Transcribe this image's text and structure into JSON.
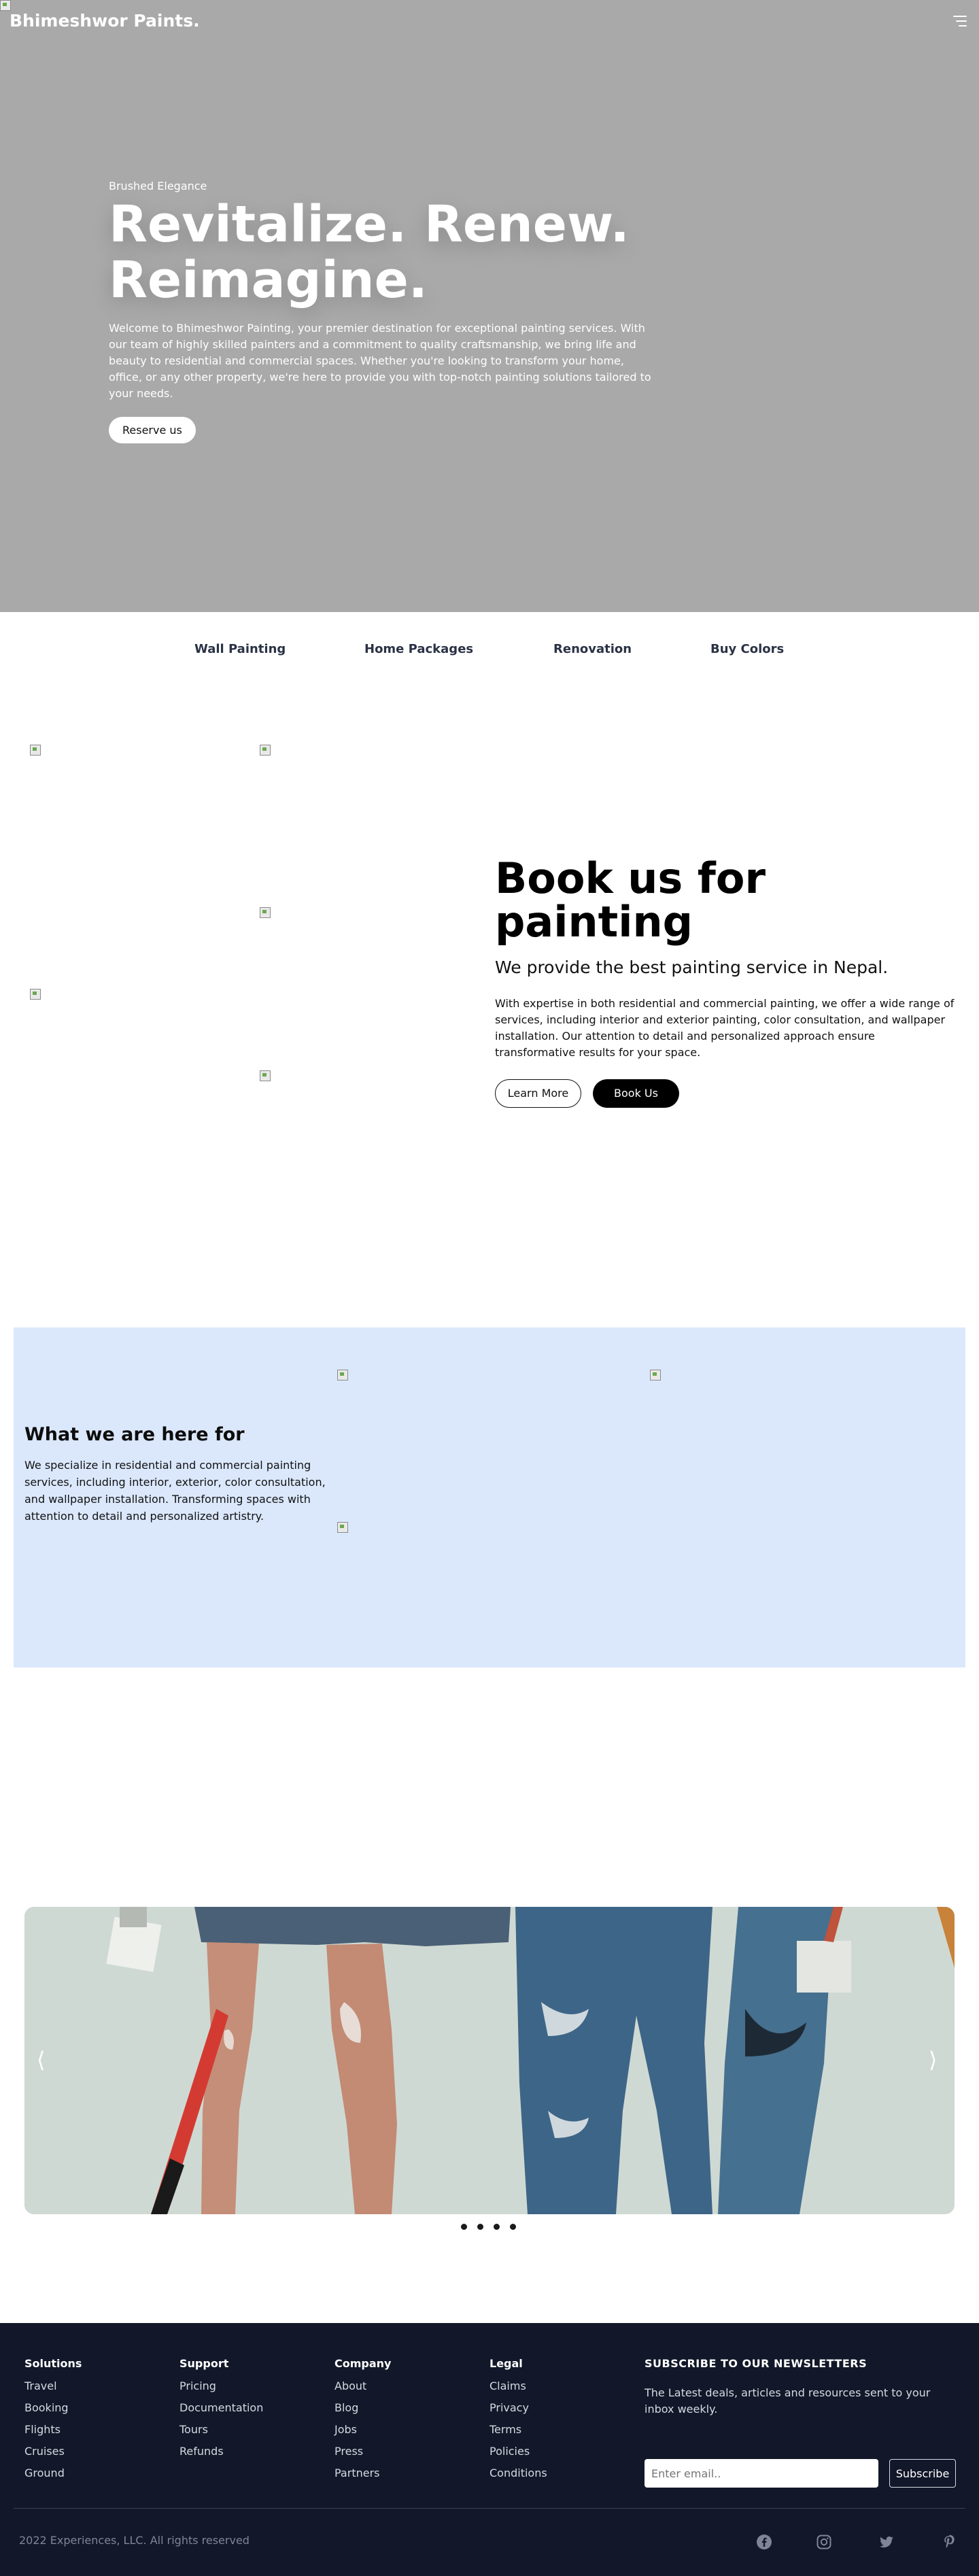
{
  "header": {
    "brand": "Bhimeshwor Paints.",
    "menu_icon": "hamburger-menu-icon"
  },
  "hero": {
    "kicker": "Brushed Elegance",
    "title_line1": "Revitalize. Renew.",
    "title_line2": "Reimagine.",
    "text": "Welcome to Bhimeshwor Painting, your premier destination for exceptional painting services. With our team of highly skilled painters and a commitment to quality craftsmanship, we bring life and beauty to residential and commercial spaces. Whether you're looking to transform your home, office, or any other property, we're here to provide you with top-notch painting solutions tailored to your needs.",
    "cta": "Reserve us",
    "background_color": "#a9a9a9"
  },
  "tabs": [
    "Wall Painting",
    "Home Packages",
    "Renovation",
    "Buy Colors"
  ],
  "book": {
    "title_line1": "Book us for",
    "title_line2": "painting",
    "subtitle": "We provide the best painting service in Nepal.",
    "text": "With expertise in both residential and commercial painting, we offer a wide range of services, including interior and exterior painting, color consultation, and wallpaper installation. Our attention to detail and personalized approach ensure transformative results for your space.",
    "learn_more": "Learn More",
    "book_us": "Book Us"
  },
  "services": {
    "title": "What we are here for",
    "text": "We specialize in residential and commercial painting services, including interior, exterior, color consultation, and wallpaper installation. Transforming spaces with attention to detail and personalized artistry.",
    "background_color": "#dbe8fc"
  },
  "carousel": {
    "prev": "⟨",
    "next": "⟩",
    "dot_count": 4
  },
  "footer": {
    "columns": [
      {
        "heading": "Solutions",
        "links": [
          "Travel",
          "Booking",
          "Flights",
          "Cruises",
          "Ground"
        ]
      },
      {
        "heading": "Support",
        "links": [
          "Pricing",
          "Documentation",
          "Tours",
          "Refunds"
        ]
      },
      {
        "heading": "Company",
        "links": [
          "About",
          "Blog",
          "Jobs",
          "Press",
          "Partners"
        ]
      },
      {
        "heading": "Legal",
        "links": [
          "Claims",
          "Privacy",
          "Terms",
          "Policies",
          "Conditions"
        ]
      }
    ],
    "newsletter_title": "SUBSCRIBE TO OUR NEWSLETTERS",
    "newsletter_text": "The Latest deals, articles and resources sent to your inbox weekly.",
    "email_placeholder": "Enter email..",
    "subscribe": "Subscribe",
    "copyright": "2022 Experiences, LLC. All rights reserved",
    "social_icons": [
      "facebook-icon",
      "instagram-icon",
      "twitter-icon",
      "pinterest-icon"
    ],
    "background_color": "#121829"
  }
}
